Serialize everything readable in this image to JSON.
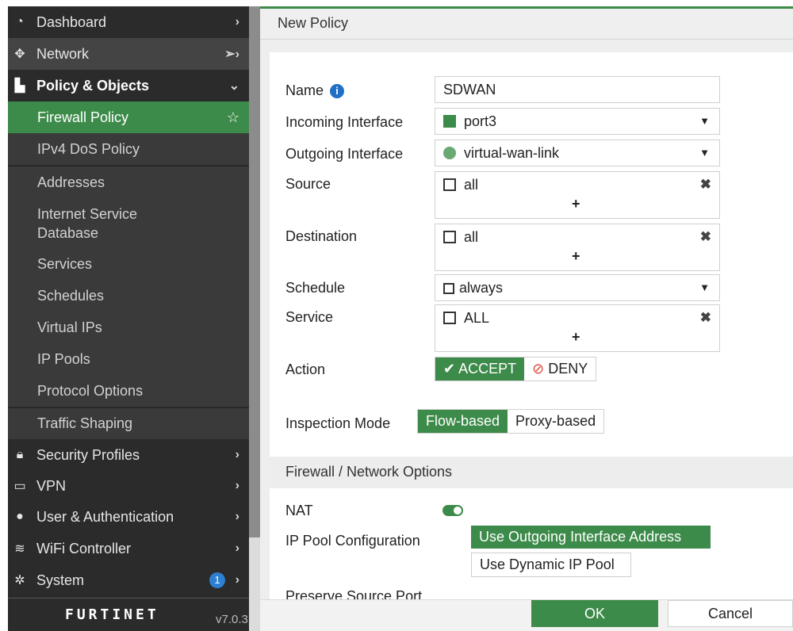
{
  "sidebar": {
    "top_items": [
      {
        "label": "Dashboard",
        "icon": "dashboard-icon"
      },
      {
        "label": "Network",
        "icon": "network-icon"
      },
      {
        "label": "Policy & Objects",
        "icon": "policy-icon"
      }
    ],
    "sub_items": [
      "Firewall Policy",
      "IPv4 DoS Policy",
      "Addresses",
      "Internet Service Database",
      "Services",
      "Schedules",
      "Virtual IPs",
      "IP Pools",
      "Protocol Options",
      "Traffic Shaping"
    ],
    "bottom_items": [
      {
        "label": "Security Profiles",
        "icon": "lock-icon"
      },
      {
        "label": "VPN",
        "icon": "laptop-icon"
      },
      {
        "label": "User & Authentication",
        "icon": "user-icon"
      },
      {
        "label": "WiFi Controller",
        "icon": "wifi-icon"
      },
      {
        "label": "System",
        "icon": "gear-icon",
        "badge": "1"
      }
    ],
    "logo": "FURTINET",
    "version": "v7.0.3"
  },
  "main": {
    "title": "New Policy",
    "form": {
      "name_label": "Name",
      "name_value": "SDWAN",
      "incoming_label": "Incoming Interface",
      "incoming_value": "port3",
      "outgoing_label": "Outgoing Interface",
      "outgoing_value": "virtual-wan-link",
      "source_label": "Source",
      "source_value": "all",
      "destination_label": "Destination",
      "destination_value": "all",
      "schedule_label": "Schedule",
      "schedule_value": "always",
      "service_label": "Service",
      "service_value": "ALL",
      "action_label": "Action",
      "accept_label": "ACCEPT",
      "deny_label": "DENY",
      "inspection_label": "Inspection Mode",
      "flow_label": "Flow-based",
      "proxy_label": "Proxy-based",
      "plus_symbol": "+"
    },
    "section_title": "Firewall / Network Options",
    "nat_label": "NAT",
    "ippool_label": "IP Pool Configuration",
    "ippool_option_1": "Use Outgoing Interface Address",
    "ippool_option_2": "Use Dynamic IP Pool",
    "cutoff_text": "Preserve Source Port"
  },
  "footer": {
    "ok_label": "OK",
    "cancel_label": "Cancel"
  },
  "colors": {
    "accent": "#3d8b4a",
    "sidebar_bg": "#2b2b2b",
    "badge": "#2d7fd2"
  }
}
